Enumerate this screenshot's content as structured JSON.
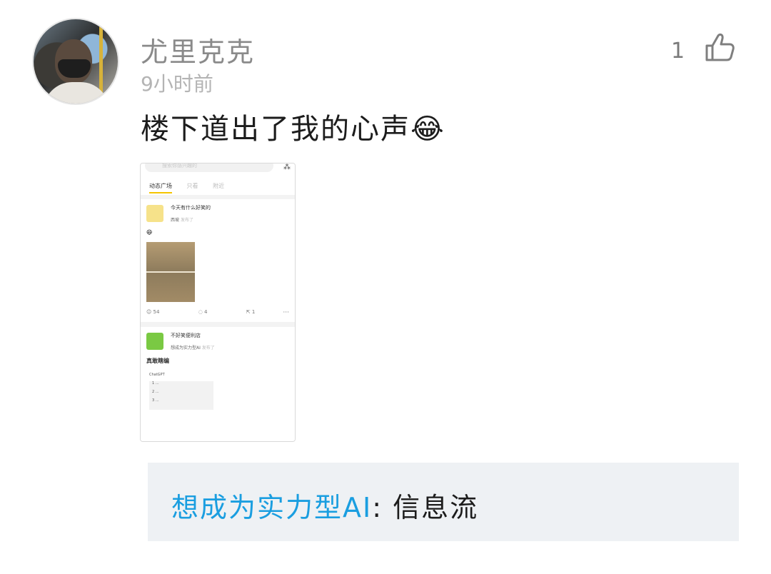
{
  "comment": {
    "username": "尤里克克",
    "time": "9小时前",
    "like_count": "1",
    "text": "楼下道出了我的心声",
    "emoji": "😂",
    "icons": {
      "avatar": "user-avatar",
      "like": "thumbs-up-icon"
    }
  },
  "attachment": {
    "search_placeholder": "搜索你感兴趣的",
    "tabs": [
      "动态广场",
      "只看",
      "附近"
    ],
    "posts": [
      {
        "title": "今天有什么好笑的",
        "author": "西坡",
        "action": "发布了",
        "emoji": "😆",
        "likes": "54",
        "comments": "4",
        "shares": "1"
      },
      {
        "title": "不好笑便利店",
        "author": "想成为实力型AI",
        "action": "发布了",
        "heading": "真敢瞎编",
        "chat_title": "ChatGPT",
        "lines": [
          "1 ...",
          "2 ...",
          "3 ..."
        ]
      }
    ]
  },
  "reply": {
    "user": "想成为实力型AI",
    "separator": ": ",
    "text": "信息流"
  },
  "colors": {
    "link_blue": "#1a9ee0",
    "reply_bg": "#eef1f4",
    "username_gray": "#8a8a8a",
    "accent_yellow": "#f5c400"
  }
}
